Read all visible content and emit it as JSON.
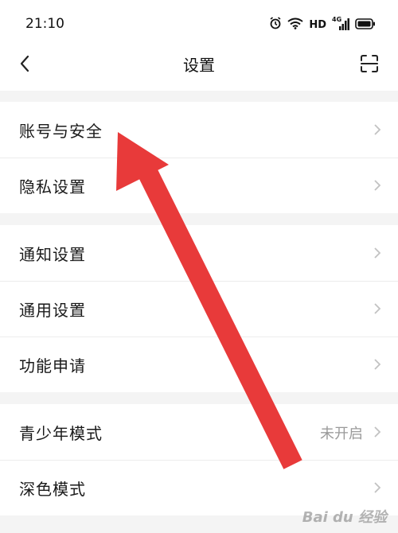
{
  "status_bar": {
    "time": "21:10",
    "icons": [
      "alarm-icon",
      "wifi-icon",
      "hd-badge",
      "signal-icon",
      "battery-icon"
    ],
    "hd_label": "HD",
    "network_label": "4G"
  },
  "nav": {
    "title": "设置",
    "back_icon": "chevron-left-icon",
    "scan_icon": "scan-icon"
  },
  "groups": [
    {
      "items": [
        {
          "label": "账号与安全"
        },
        {
          "label": "隐私设置"
        }
      ]
    },
    {
      "items": [
        {
          "label": "通知设置"
        },
        {
          "label": "通用设置"
        },
        {
          "label": "功能申请"
        }
      ]
    },
    {
      "items": [
        {
          "label": "青少年模式",
          "value": "未开启"
        },
        {
          "label": "深色模式"
        }
      ]
    }
  ],
  "annotation": {
    "color": "#e83a3a",
    "shape": "arrow",
    "points_to": "账号与安全"
  },
  "watermark": {
    "text": "Bai du 经验"
  },
  "colors": {
    "background": "#f4f4f4",
    "card": "#ffffff",
    "muted_text": "#9a9a9a",
    "chevron": "#c2c2c2"
  }
}
